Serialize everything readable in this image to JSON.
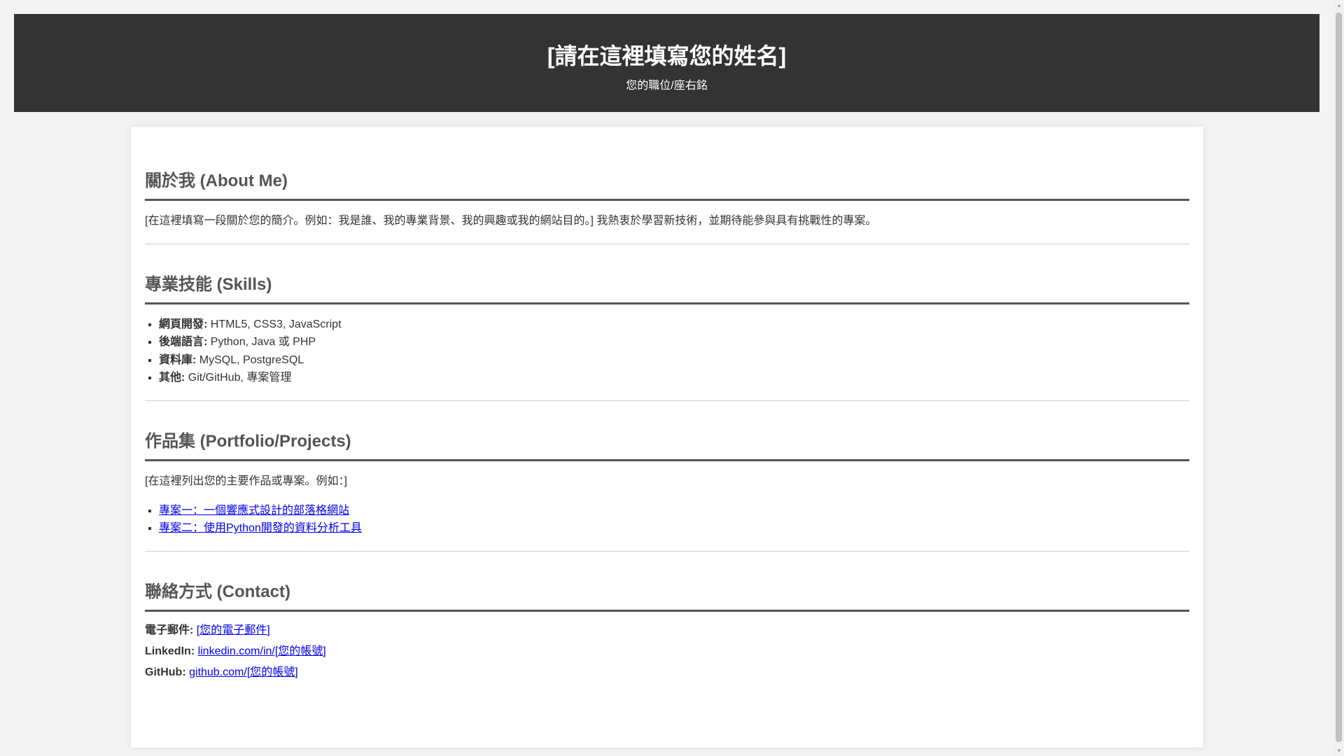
{
  "header": {
    "name": "[請在這裡填寫您的姓名]",
    "tagline": "您的職位/座右銘"
  },
  "about": {
    "title": "關於我 (About Me)",
    "text": "[在這裡填寫一段關於您的簡介。例如：我是誰、我的專業背景、我的興趣或我的網站目的。] 我熱衷於學習新技術，並期待能參與具有挑戰性的專案。"
  },
  "skills": {
    "title": "專業技能 (Skills)",
    "items": [
      {
        "label": "網頁開發:",
        "value": " HTML5, CSS3, JavaScript"
      },
      {
        "label": "後端語言:",
        "value": " Python, Java 或 PHP"
      },
      {
        "label": "資料庫:",
        "value": " MySQL, PostgreSQL"
      },
      {
        "label": "其他:",
        "value": " Git/GitHub, 專案管理"
      }
    ]
  },
  "portfolio": {
    "title": "作品集 (Portfolio/Projects)",
    "intro": "[在這裡列出您的主要作品或專案。例如：]",
    "projects": [
      "專案一：一個響應式設計的部落格網站",
      "專案二：使用Python開發的資料分析工具"
    ]
  },
  "contact": {
    "title": "聯絡方式 (Contact)",
    "items": [
      {
        "label": "電子郵件:",
        "link": "[您的電子郵件]"
      },
      {
        "label": "LinkedIn:",
        "link": "linkedin.com/in/[您的帳號]"
      },
      {
        "label": "GitHub:",
        "link": "github.com/[您的帳號]"
      }
    ]
  },
  "colors": {
    "header_bg": "#333333",
    "link": "#0000ee",
    "heading": "#555555"
  }
}
